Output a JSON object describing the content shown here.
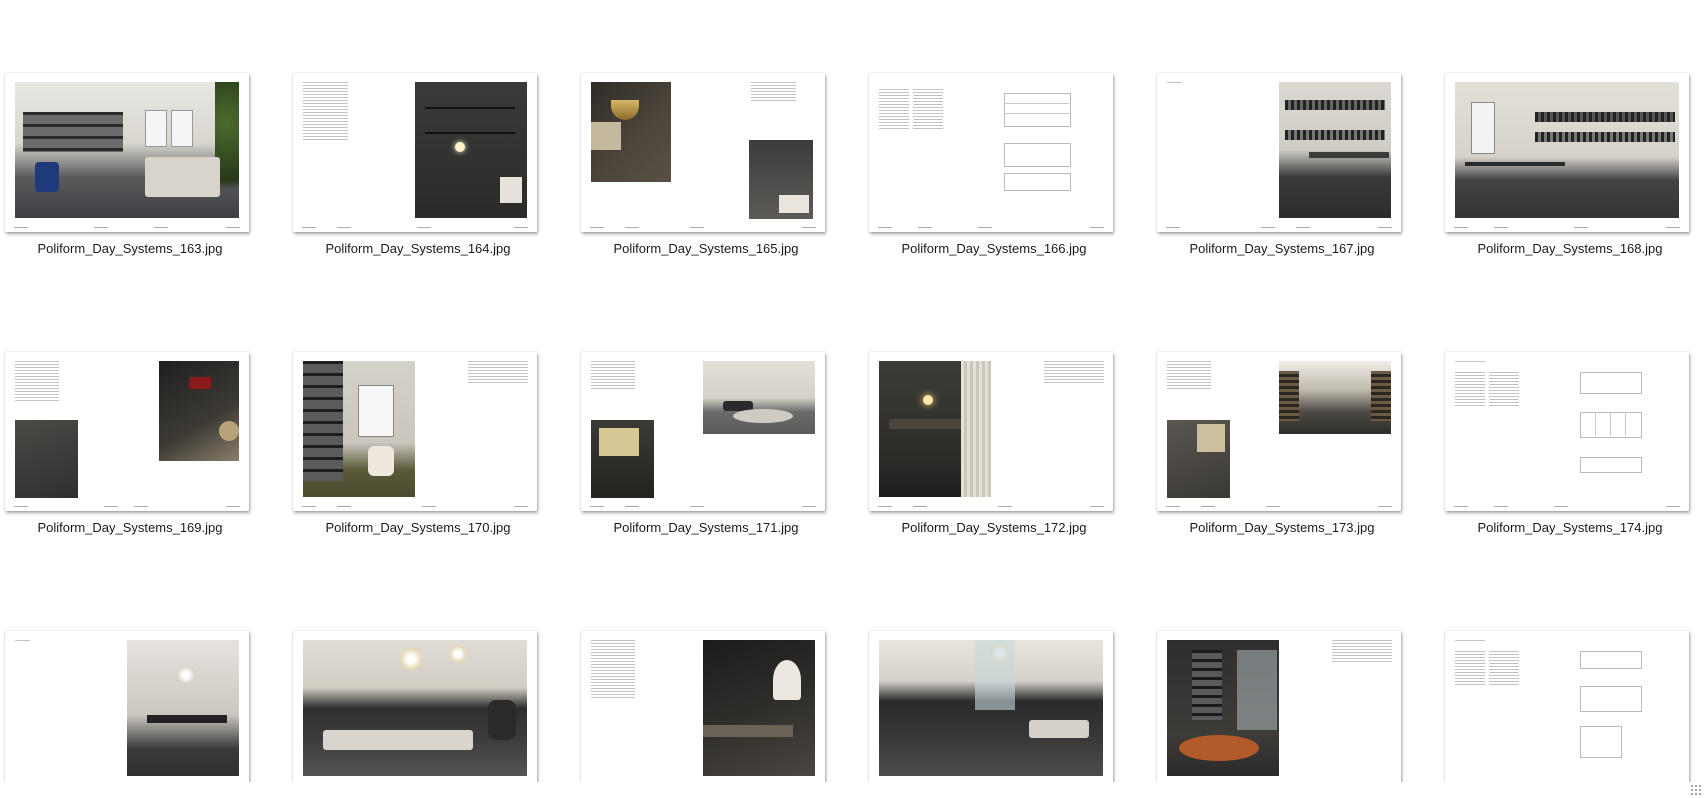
{
  "files": [
    {
      "name": "Poliform_Day_Systems_163.jpg"
    },
    {
      "name": "Poliform_Day_Systems_164.jpg"
    },
    {
      "name": "Poliform_Day_Systems_165.jpg"
    },
    {
      "name": "Poliform_Day_Systems_166.jpg"
    },
    {
      "name": "Poliform_Day_Systems_167.jpg"
    },
    {
      "name": "Poliform_Day_Systems_168.jpg"
    },
    {
      "name": "Poliform_Day_Systems_169.jpg"
    },
    {
      "name": "Poliform_Day_Systems_170.jpg"
    },
    {
      "name": "Poliform_Day_Systems_171.jpg"
    },
    {
      "name": "Poliform_Day_Systems_172.jpg"
    },
    {
      "name": "Poliform_Day_Systems_173.jpg"
    },
    {
      "name": "Poliform_Day_Systems_174.jpg"
    },
    {
      "name": ""
    },
    {
      "name": ""
    },
    {
      "name": ""
    },
    {
      "name": ""
    },
    {
      "name": ""
    },
    {
      "name": ""
    }
  ],
  "icons": {
    "resize": "resize-grip-icon"
  }
}
